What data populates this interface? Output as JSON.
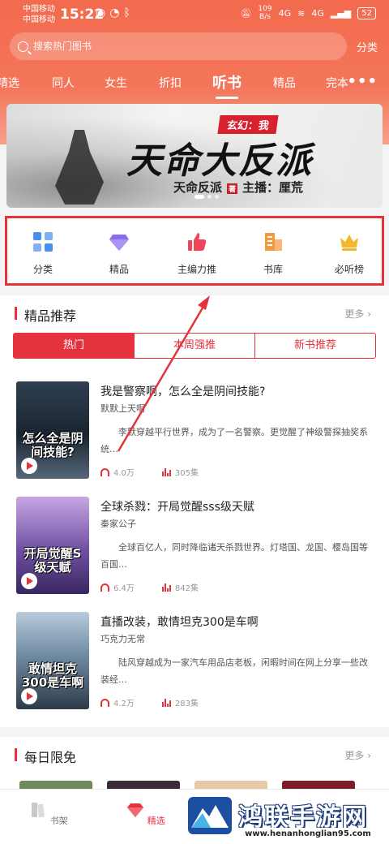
{
  "status_bar": {
    "carrier_1": "中国移动",
    "carrier_2": "中国移动",
    "time": "15:22",
    "net_speed": "109",
    "net_unit": "B/s",
    "signal": "4G",
    "battery": "52"
  },
  "header": {
    "search_placeholder": "搜索热门图书",
    "category_link": "分类",
    "tabs": [
      {
        "label": "精选"
      },
      {
        "label": "同人"
      },
      {
        "label": "女生"
      },
      {
        "label": "折扣"
      },
      {
        "label": "听书"
      },
      {
        "label": "精品"
      },
      {
        "label": "完本"
      }
    ],
    "active_tab": "听书"
  },
  "banner": {
    "tag": "玄幻：我",
    "title": "天命大反派",
    "author_line": "天命反派",
    "author_mark": "著",
    "narrator_line": "主播：厘荒"
  },
  "quick_nav": [
    {
      "label": "分类",
      "icon": "grid-icon",
      "color": "#4a8ef0"
    },
    {
      "label": "精品",
      "icon": "diamond-icon",
      "color": "#8b6cf0"
    },
    {
      "label": "主编力推",
      "icon": "thumbs-up-icon",
      "color": "#f0445a"
    },
    {
      "label": "书库",
      "icon": "building-icon",
      "color": "#f49a3c"
    },
    {
      "label": "必听榜",
      "icon": "crown-icon",
      "color": "#f2b82c"
    }
  ],
  "featured": {
    "title": "精品推荐",
    "more": "更多",
    "segments": [
      "热门",
      "本周强推",
      "新书推荐"
    ],
    "active_segment": "热门",
    "books": [
      {
        "title": "我是警察啊，怎么全是阴间技能?",
        "author": "默默上天啊",
        "description": "李默穿越平行世界，成为了一名警察。更觉醒了神级警探抽奖系统…",
        "listens": "4.0万",
        "episodes": "305集",
        "cover_text": "怎么全是阴间技能?",
        "cover_colors": [
          "#1d2c3a",
          "#4a5a6a"
        ]
      },
      {
        "title": "全球杀戮：开局觉醒sss级天赋",
        "author": "秦家公子",
        "description": "全球百亿人，同时降临诸天杀戮世界。灯塔国、龙国、樱岛国等百国…",
        "listens": "6.4万",
        "episodes": "842集",
        "cover_text": "开局觉醒S级天赋",
        "cover_colors": [
          "#4c3a7a",
          "#b58ed6"
        ]
      },
      {
        "title": "直播改装，敢情坦克300是车啊",
        "author": "巧克力无常",
        "description": "陆风穿越成为一家汽车用品店老板，闲暇时间在网上分享一些改装经…",
        "listens": "4.2万",
        "episodes": "283集",
        "cover_text": "敢情坦克300是车啊",
        "cover_colors": [
          "#8aa6bd",
          "#2e3b48"
        ]
      }
    ]
  },
  "daily_free": {
    "title": "每日限免",
    "more": "更多",
    "thumb_colors": [
      "#6d8a5a",
      "#3a2a3a",
      "#e6c9a8",
      "#7a1f2a"
    ]
  },
  "bottom_nav": [
    {
      "label": "书架",
      "icon": "bookshelf-icon"
    },
    {
      "label": "精选",
      "icon": "gem-icon"
    }
  ],
  "active_bottom": "精选",
  "watermark": {
    "title": "鸿联手游网",
    "url": "www.henanhonglian95.com"
  },
  "colors": {
    "accent": "#e4333d",
    "header_bg": "#f36a4e"
  }
}
